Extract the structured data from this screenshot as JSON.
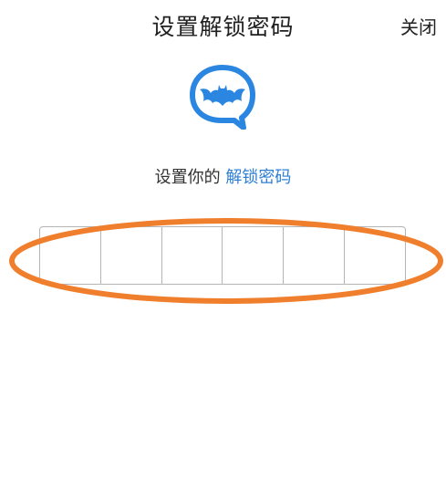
{
  "header": {
    "title": "设置解锁密码",
    "close_label": "关闭"
  },
  "logo": {
    "icon": "bat-chat-bubble-icon",
    "color": "#2a86e0"
  },
  "prompt": {
    "text": "设置你的",
    "highlight": "解锁密码",
    "highlight_color": "#2f7fd4"
  },
  "passcode": {
    "length": 6,
    "digits": [
      "",
      "",
      "",
      "",
      "",
      ""
    ]
  },
  "annotation": {
    "shape": "ellipse",
    "color": "#f07f2d"
  }
}
